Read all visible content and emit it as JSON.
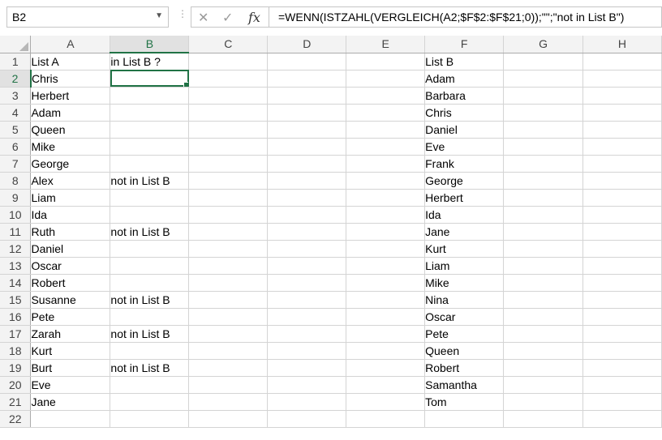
{
  "name_box": {
    "value": "B2"
  },
  "formula_bar": {
    "cancel_icon": "✕",
    "enter_icon": "✓",
    "fx_label": "fx",
    "formula": "=WENN(ISTZAHL(VERGLEICH(A2;$F$2:$F$21;0));\"\";\"not in List B\")"
  },
  "columns": [
    "A",
    "B",
    "C",
    "D",
    "E",
    "F",
    "G",
    "H"
  ],
  "selected_column": "B",
  "selected_row": 2,
  "active_cell": "B2",
  "rows": [
    {
      "num": "1",
      "A": "List A",
      "B": "in List B ?",
      "F": "List B"
    },
    {
      "num": "2",
      "A": "Chris",
      "B": "",
      "F": "Adam"
    },
    {
      "num": "3",
      "A": "Herbert",
      "B": "",
      "F": "Barbara"
    },
    {
      "num": "4",
      "A": "Adam",
      "B": "",
      "F": "Chris"
    },
    {
      "num": "5",
      "A": "Queen",
      "B": "",
      "F": "Daniel"
    },
    {
      "num": "6",
      "A": "Mike",
      "B": "",
      "F": "Eve"
    },
    {
      "num": "7",
      "A": "George",
      "B": "",
      "F": "Frank"
    },
    {
      "num": "8",
      "A": "Alex",
      "B": "not in List B",
      "F": "George"
    },
    {
      "num": "9",
      "A": "Liam",
      "B": "",
      "F": "Herbert"
    },
    {
      "num": "10",
      "A": "Ida",
      "B": "",
      "F": "Ida"
    },
    {
      "num": "11",
      "A": "Ruth",
      "B": "not in List B",
      "F": "Jane"
    },
    {
      "num": "12",
      "A": "Daniel",
      "B": "",
      "F": "Kurt"
    },
    {
      "num": "13",
      "A": "Oscar",
      "B": "",
      "F": "Liam"
    },
    {
      "num": "14",
      "A": "Robert",
      "B": "",
      "F": "Mike"
    },
    {
      "num": "15",
      "A": "Susanne",
      "B": "not in List B",
      "F": "Nina"
    },
    {
      "num": "16",
      "A": "Pete",
      "B": "",
      "F": "Oscar"
    },
    {
      "num": "17",
      "A": "Zarah",
      "B": "not in List B",
      "F": "Pete"
    },
    {
      "num": "18",
      "A": "Kurt",
      "B": "",
      "F": "Queen"
    },
    {
      "num": "19",
      "A": "Burt",
      "B": "not in List B",
      "F": "Robert"
    },
    {
      "num": "20",
      "A": "Eve",
      "B": "",
      "F": "Samantha"
    },
    {
      "num": "21",
      "A": "Jane",
      "B": "",
      "F": "Tom"
    },
    {
      "num": "22",
      "A": "",
      "B": "",
      "F": ""
    }
  ]
}
